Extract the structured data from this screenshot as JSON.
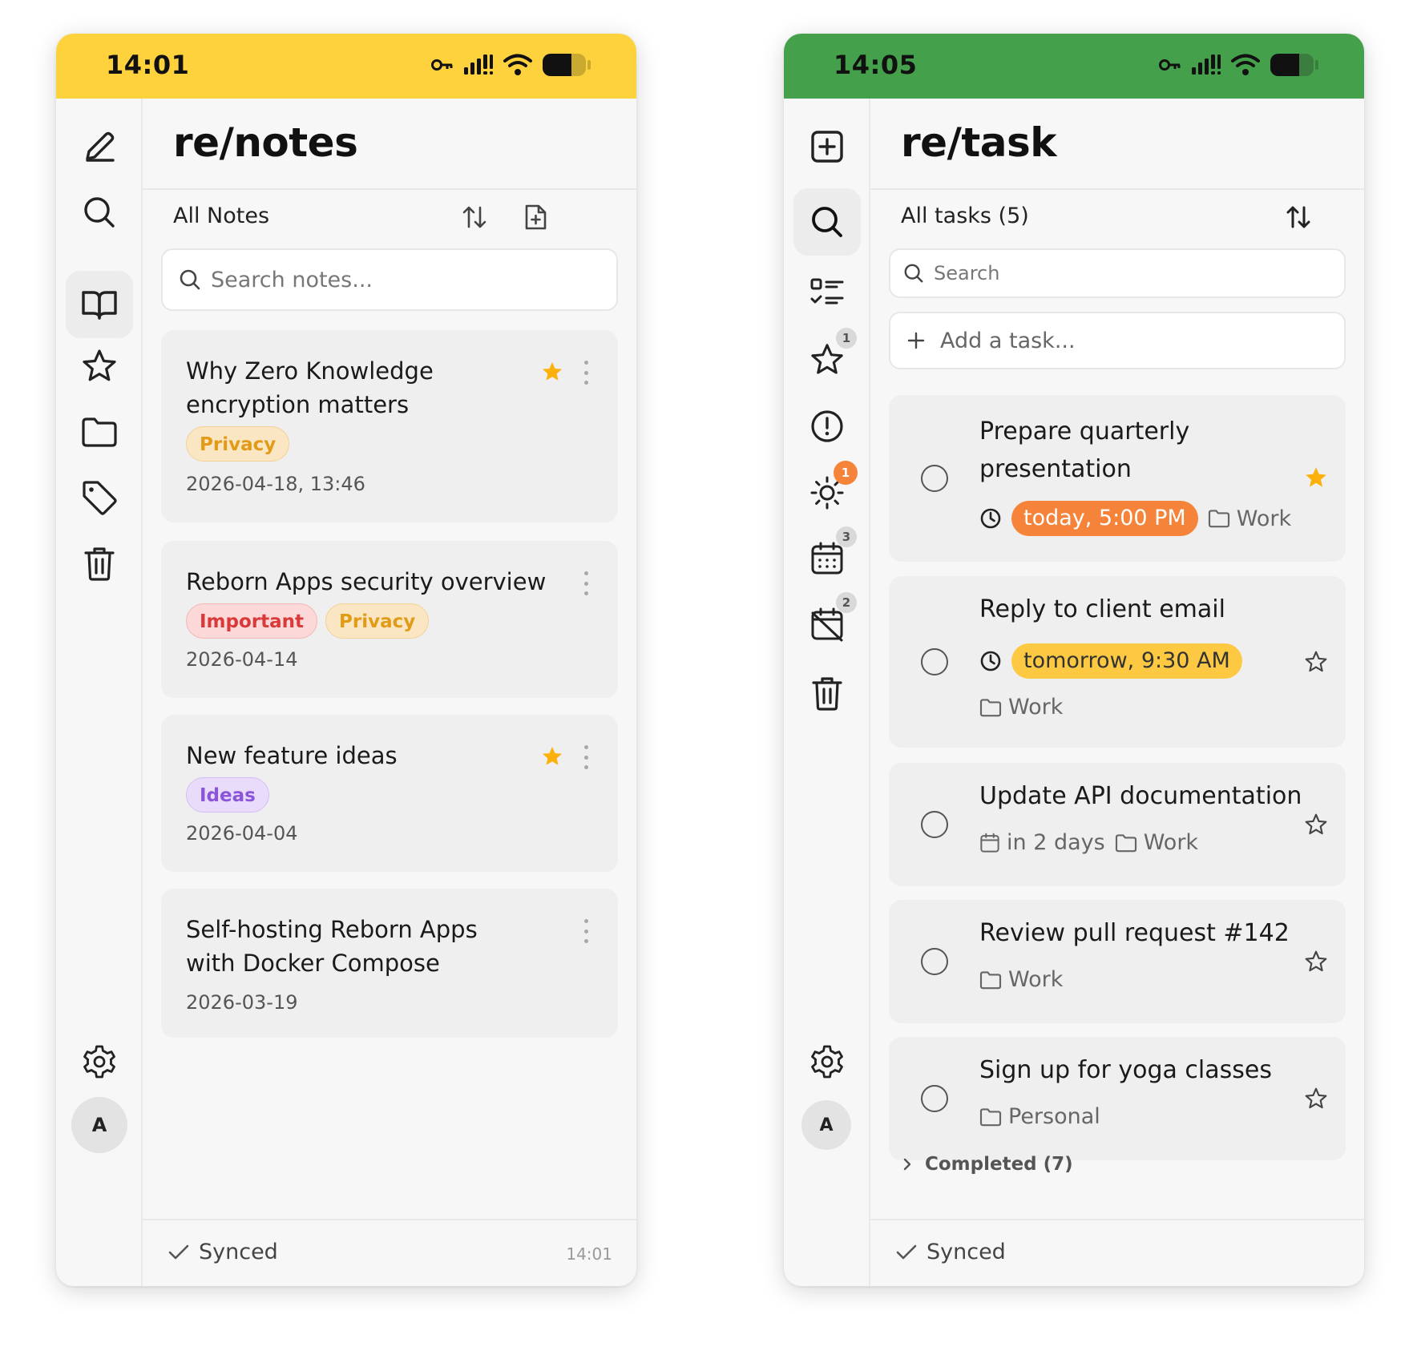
{
  "notes_app": {
    "status_time": "14:01",
    "brand": "re/notes",
    "list_title": "All Notes",
    "search_placeholder": "Search notes...",
    "notes": [
      {
        "title": "Why Zero Knowledge encryption matters",
        "tags": [
          "Privacy"
        ],
        "date": "2026-04-18, 13:46",
        "starred": true
      },
      {
        "title": "Reborn Apps security overview",
        "tags": [
          "Important",
          "Privacy"
        ],
        "date": "2026-04-14",
        "starred": false
      },
      {
        "title": "New feature ideas",
        "tags": [
          "Ideas"
        ],
        "date": "2026-04-04",
        "starred": true
      },
      {
        "title": "Self-hosting Reborn Apps with Docker Compose",
        "tags": [],
        "date": "2026-03-19",
        "starred": false
      }
    ],
    "avatar_initial": "A",
    "sync_label": "Synced",
    "sync_time": "14:01",
    "accent_color": "#fdd23d"
  },
  "tasks_app": {
    "status_time": "14:05",
    "brand": "re/task",
    "list_title": "All tasks (5)",
    "search_placeholder": "Search",
    "add_placeholder": "Add a task...",
    "nav_badges": {
      "starred": "1",
      "today": "1",
      "upcoming": "3",
      "overdue": "2"
    },
    "tasks": [
      {
        "title": "Prepare quarterly presentation",
        "due": "today, 5:00 PM",
        "list": "Work",
        "starred": true
      },
      {
        "title": "Reply to client email",
        "due": "tomorrow, 9:30 AM",
        "list": "Work",
        "starred": false
      },
      {
        "title": "Update API documentation",
        "due": "in 2 days",
        "list": "Work",
        "starred": false
      },
      {
        "title": "Review pull request #142",
        "due": "",
        "list": "Work",
        "starred": false
      },
      {
        "title": "Sign up for yoga classes",
        "due": "",
        "list": "Personal",
        "starred": false
      }
    ],
    "completed_label": "Completed (7)",
    "avatar_initial": "A",
    "sync_label": "Synced",
    "accent_color": "#45a04b"
  },
  "colors": {
    "star": "#fbb10a",
    "today_pill": "#f5843a",
    "tomorrow_pill": "#fdc943"
  }
}
